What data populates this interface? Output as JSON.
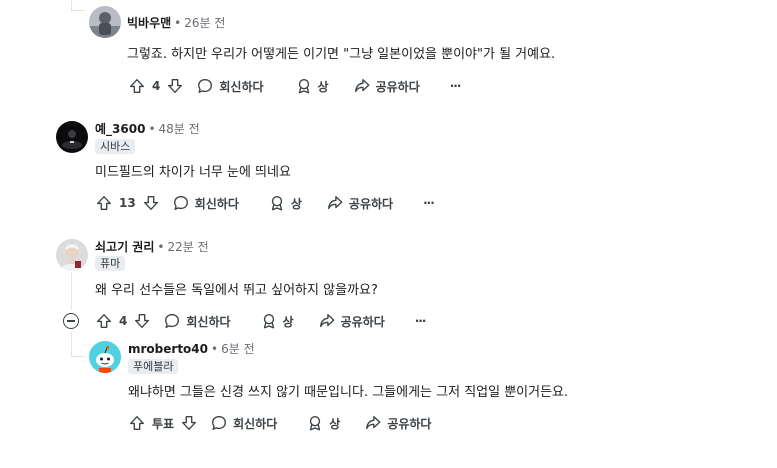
{
  "comments": [
    {
      "author": "빅바우맨",
      "time": "26분 전",
      "flair": "",
      "text": "그렇죠. 하지만 우리가 어떻게든 이기면 \"그냥 일본이었을 뿐이야\"가 될 거예요.",
      "votes": "4"
    },
    {
      "author": "예_3600",
      "time": "48분 전",
      "flair": "시바스",
      "text": "미드필드의 차이가 너무 눈에 띄네요",
      "votes": "13"
    },
    {
      "author": "쇠고기 권리",
      "time": "22분 전",
      "flair": "퓨마",
      "text": "왜 우리 선수들은 독일에서 뛰고 싶어하지 않을까요?",
      "votes": "4"
    },
    {
      "author": "mroberto40",
      "time": "6분 전",
      "flair": "푸에블라",
      "text": "왜냐하면 그들은 신경 쓰지 않기 때문입니다. 그들에게는 그저 직업일 뿐이거든요.",
      "votes": "투표"
    }
  ],
  "labels": {
    "separator": "•",
    "reply": "회신하다",
    "award": "상",
    "share": "공유하다",
    "more": "···"
  },
  "icons": {
    "upvote": "upvote-arrow-icon",
    "downvote": "downvote-arrow-icon",
    "reply": "comment-bubble-icon",
    "award": "award-icon",
    "share": "share-arrow-icon",
    "more": "more-options-icon",
    "collapse": "collapse-minus-icon"
  },
  "colors": {
    "text": "#1c1c1c",
    "meta": "#6a6e73",
    "action": "#3c4347",
    "flair_bg": "#eaedef",
    "thread_line": "#e2e4e6",
    "snoo": "#4fd1e0"
  }
}
